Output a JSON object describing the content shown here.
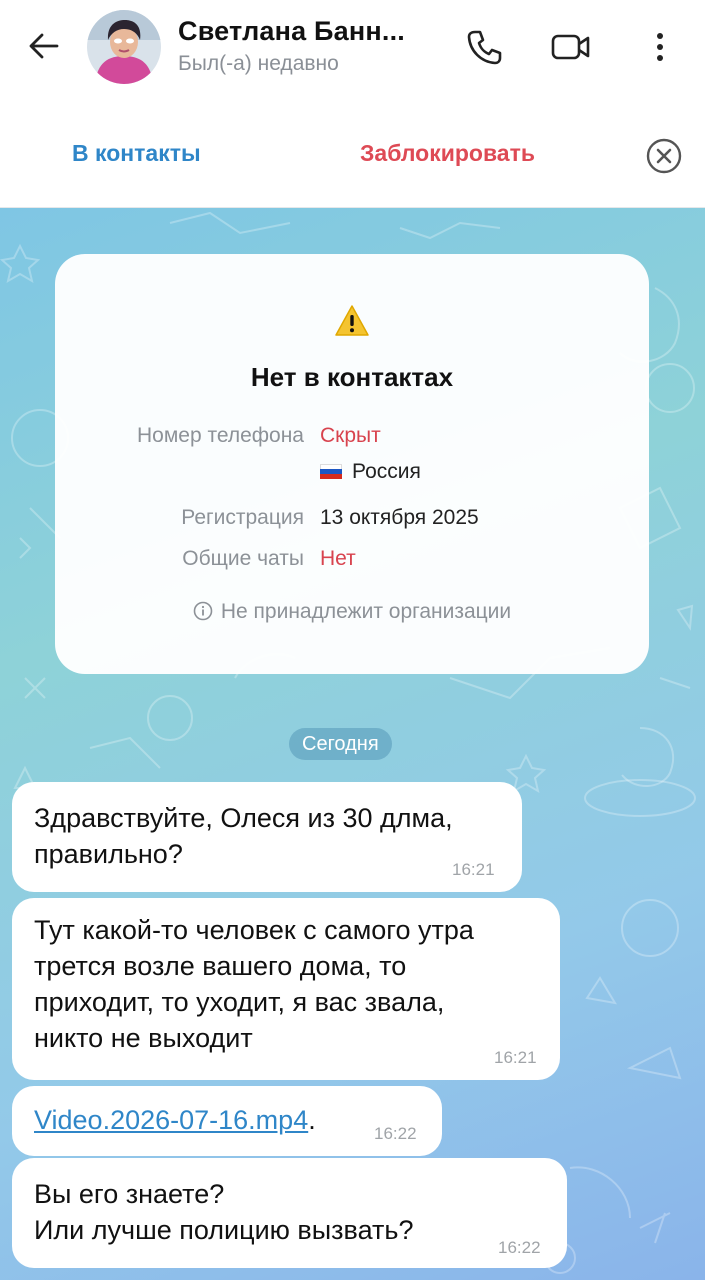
{
  "header": {
    "contact_name": "Светлана Банн...",
    "status": "Был(-а) недавно",
    "icons": {
      "back": "arrow-left-icon",
      "call": "phone-icon",
      "video": "video-camera-icon",
      "more": "more-vertical-icon"
    }
  },
  "action_bar": {
    "add_contact_label": "В контакты",
    "block_label": "Заблокировать",
    "close_icon": "close-circle-icon"
  },
  "info_card": {
    "icon": "warning-icon",
    "title": "Нет в контактах",
    "phone_label": "Номер телефона",
    "phone_value": "Скрыт",
    "country": "Россия",
    "registration_label": "Регистрация",
    "registration_value": "13 октября 2025",
    "common_chats_label": "Общие чаты",
    "common_chats_value": "Нет",
    "organization_note": "Не принадлежит организации"
  },
  "date_separator": "Сегодня",
  "messages": [
    {
      "text": "Здравствуйте, Олеся из 30 длма,\nправильно?",
      "time": "16:21"
    },
    {
      "text": "Тут какой-то человек с самого утра\nтрется возле вашего дома, то\nприходит, то уходит, я вас звала,\nникто не выходит",
      "time": "16:21"
    },
    {
      "link_text": "Video.2026-07-16.mp4",
      "after_text": ".",
      "time": "16:22"
    },
    {
      "text": "Вы его знаете?\nИли лучше полицию вызвать?",
      "time": "16:22"
    }
  ],
  "colors": {
    "accent_blue": "#2f86c8",
    "danger_red": "#de4a55",
    "chat_bg": "#8ed2d8",
    "warning_yellow": "#f4c430"
  }
}
